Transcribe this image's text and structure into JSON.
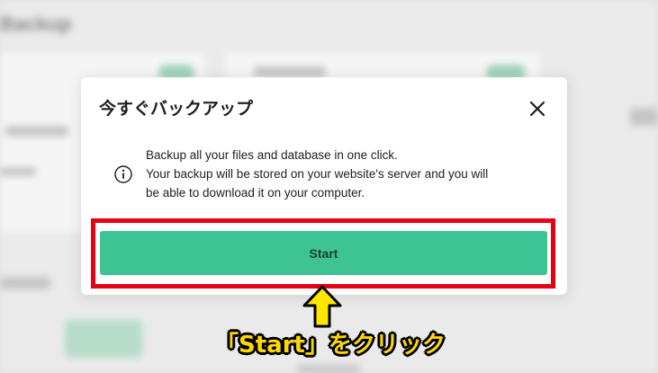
{
  "background": {
    "title": "Backup"
  },
  "modal": {
    "title": "今すぐバックアップ",
    "message_lines": [
      "Backup all your files and database in one click.",
      "Your backup will be stored on your website's server and you will",
      "be able to download it on your computer."
    ],
    "start_label": "Start",
    "icons": {
      "close": "close-icon",
      "info": "info-icon"
    }
  },
  "annotation": {
    "caption": "「Start」をクリック",
    "arrow": "up-arrow-icon"
  },
  "colors": {
    "accent_green": "#3ec494",
    "highlight_red": "#e60012",
    "caption_yellow": "#ffd700"
  }
}
